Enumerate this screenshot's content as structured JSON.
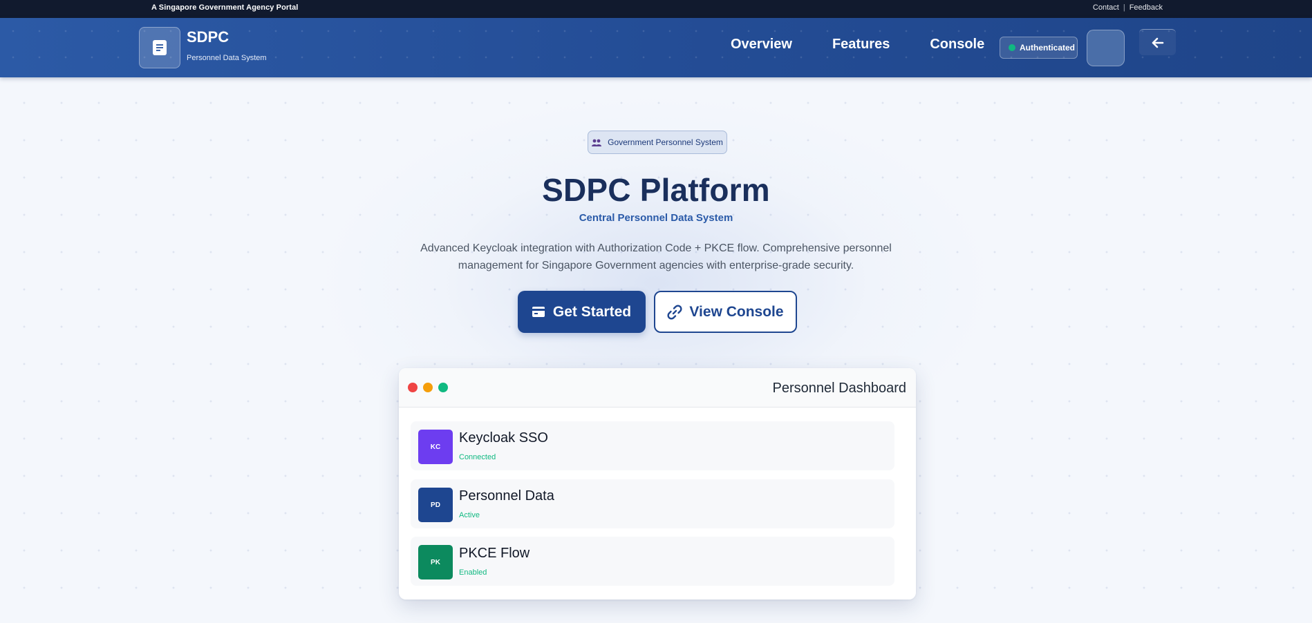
{
  "topbar": {
    "portal_label": "A Singapore Government Agency Portal",
    "contact": "Contact",
    "separator": "|",
    "feedback": "Feedback"
  },
  "header": {
    "brand_title": "SDPC",
    "brand_subtitle": "Personnel Data System",
    "nav": [
      "Overview",
      "Features",
      "Console"
    ],
    "auth_badge": "Authenticated",
    "icons": {
      "logo": "document-icon",
      "logout": "arrow-left-icon"
    }
  },
  "hero": {
    "tag_label": "Government Personnel System",
    "tag_icon": "users-icon",
    "title": "SDPC Platform",
    "subtitle": "Central Personnel Data System",
    "description": "Advanced Keycloak integration with Authorization Code + PKCE flow. Comprehensive personnel management for Singapore Government agencies with enterprise-grade security.",
    "primary_button": "Get Started",
    "primary_icon": "id-card-icon",
    "secondary_button": "View Console",
    "secondary_icon": "link-icon"
  },
  "dashboard": {
    "title": "Personnel Dashboard",
    "window_dots": [
      "#ef4444",
      "#f59e0b",
      "#10b981"
    ],
    "rows": [
      {
        "badge": "KC",
        "name": "Keycloak SSO",
        "status": "Connected",
        "color": "#6d3df0"
      },
      {
        "badge": "PD",
        "name": "Personnel Data",
        "status": "Active",
        "color": "#1e4690"
      },
      {
        "badge": "PK",
        "name": "PKCE Flow",
        "status": "Enabled",
        "color": "#0c8a5e"
      }
    ]
  },
  "colors": {
    "topbar": "#111a2e",
    "header": "#244d96",
    "accent": "#1e4690",
    "status_green": "#10b981"
  }
}
